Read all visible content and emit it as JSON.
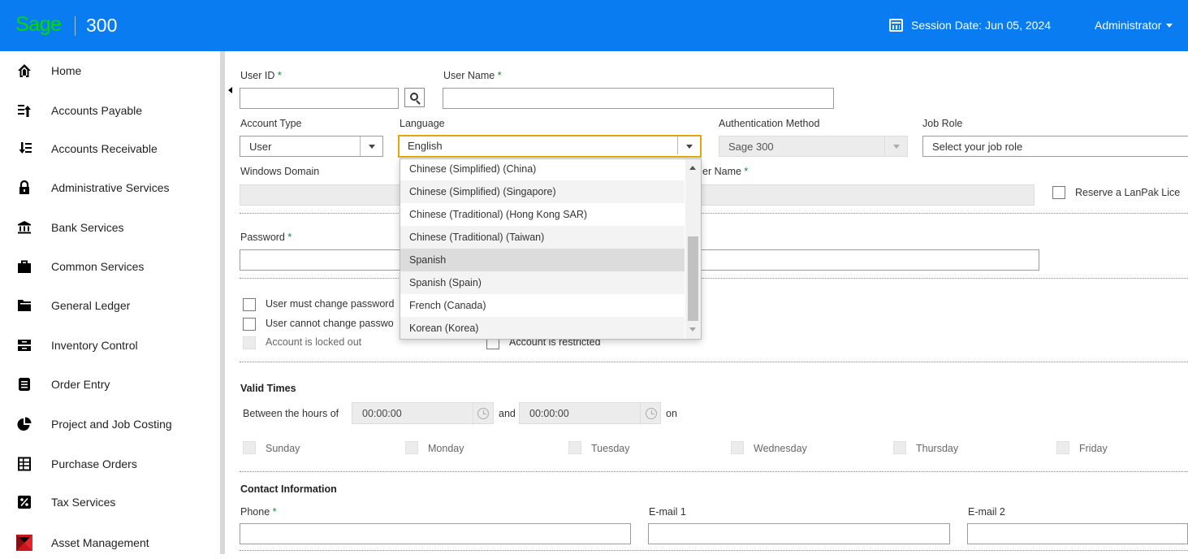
{
  "header": {
    "brand_sage": "Sage",
    "brand_product": "300",
    "session_label": "Session Date:",
    "session_date": "Jun 05, 2024",
    "user": "Administrator",
    "brand_color": "#0a7cf2",
    "logo_color": "#00dc00"
  },
  "sidebar": {
    "items": [
      {
        "label": "Home",
        "icon": "home-icon"
      },
      {
        "label": "Accounts Payable",
        "icon": "accounts-payable-icon"
      },
      {
        "label": "Accounts Receivable",
        "icon": "accounts-receivable-icon"
      },
      {
        "label": "Administrative Services",
        "icon": "lock-icon"
      },
      {
        "label": "Bank Services",
        "icon": "bank-icon"
      },
      {
        "label": "Common Services",
        "icon": "briefcase-icon"
      },
      {
        "label": "General Ledger",
        "icon": "folder-icon"
      },
      {
        "label": "Inventory Control",
        "icon": "inventory-icon"
      },
      {
        "label": "Order Entry",
        "icon": "document-icon"
      },
      {
        "label": "Project and Job Costing",
        "icon": "pie-chart-icon"
      },
      {
        "label": "Purchase Orders",
        "icon": "purchase-orders-icon"
      },
      {
        "label": "Tax Services",
        "icon": "percent-icon"
      },
      {
        "label": "Asset Management",
        "icon": "asset-management-icon"
      }
    ]
  },
  "form": {
    "user_id_label": "User ID",
    "user_id_value": "",
    "user_name_label": "User Name",
    "user_name_value": "",
    "required_mark": "*",
    "account_type_label": "Account Type",
    "account_type_value": "User",
    "language_label": "Language",
    "language_value": "English",
    "auth_method_label": "Authentication Method",
    "auth_method_value": "Sage 300",
    "job_role_label": "Job Role",
    "job_role_value": "Select your job role",
    "windows_domain_label": "Windows Domain",
    "windows_user_name_label_partial": "er Name",
    "reserve_lanpak_label": "Reserve a LanPak Lice",
    "password_label": "Password",
    "must_change_password": "User must change password",
    "cannot_change_password": "User cannot change passwo",
    "account_locked": "Account is locked out",
    "account_restricted": "Account is restricted",
    "valid_times_title": "Valid Times",
    "between_hours_label": "Between the hours of",
    "start_time": "00:00:00",
    "and_label": "and",
    "end_time": "00:00:00",
    "on_label": "on",
    "days": [
      "Sunday",
      "Monday",
      "Tuesday",
      "Wednesday",
      "Thursday",
      "Friday"
    ],
    "contact_title": "Contact Information",
    "phone_label": "Phone",
    "email1_label": "E-mail 1",
    "email2_label": "E-mail 2"
  },
  "language_dropdown": {
    "options": [
      "Chinese (Simplified) (China)",
      "Chinese (Simplified) (Singapore)",
      "Chinese (Traditional) (Hong Kong SAR)",
      "Chinese (Traditional) (Taiwan)",
      "Spanish",
      "Spanish (Spain)",
      "French (Canada)",
      "Korean (Korea)"
    ],
    "highlighted": "Spanish"
  }
}
